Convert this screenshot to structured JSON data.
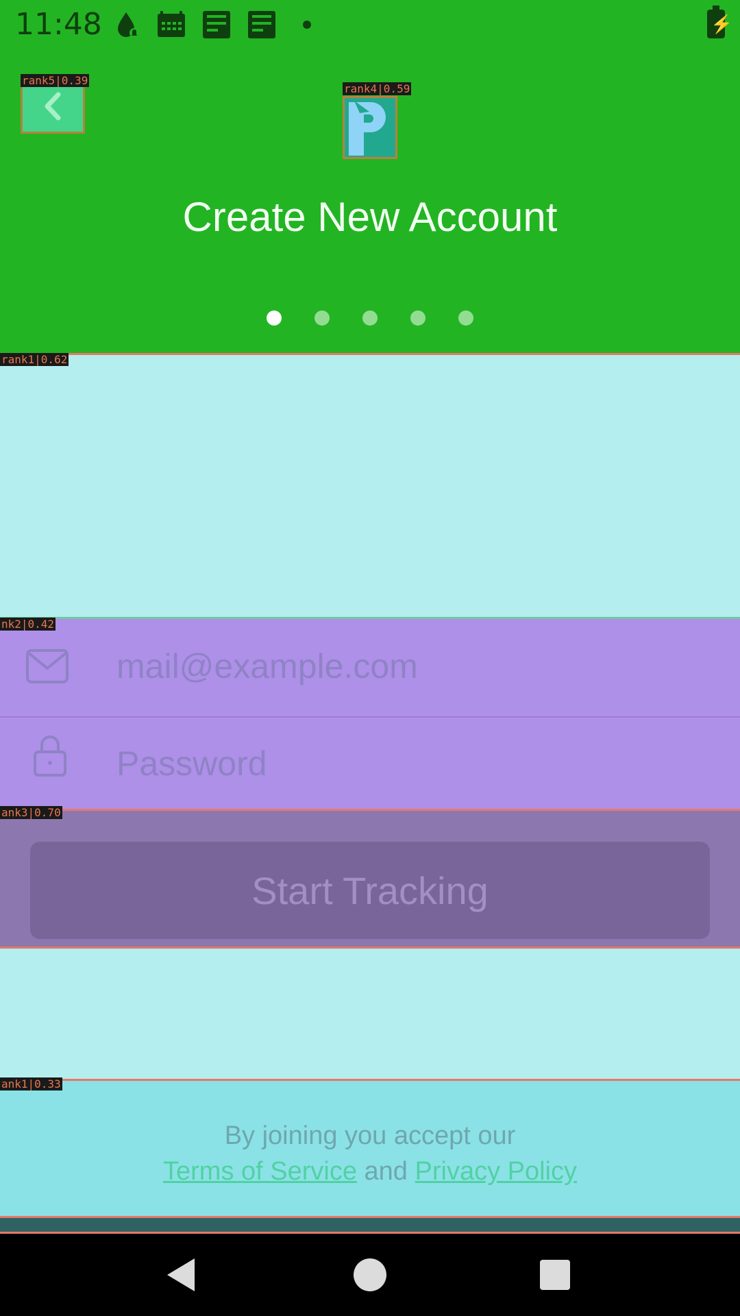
{
  "status_bar": {
    "time": "11:48"
  },
  "header": {
    "back_tag": "rank5|0.39",
    "logo_tag": "rank4|0.59",
    "title": "Create New Account",
    "pager": {
      "count": 5,
      "active_index": 0
    }
  },
  "regions": {
    "top_tag": "rank1|0.62",
    "form_tag": "nk2|0.42",
    "cta_tag": "ank3|0.70",
    "footer_tag": "ank1|0.33"
  },
  "form": {
    "email": {
      "placeholder": "mail@example.com",
      "icon": "mail-icon"
    },
    "password": {
      "placeholder": "Password",
      "icon": "lock-icon"
    }
  },
  "cta": {
    "label": "Start Tracking"
  },
  "footer": {
    "line1": "By joining you accept our",
    "terms": "Terms of Service",
    "and": "and",
    "privacy": "Privacy Policy"
  },
  "colors": {
    "header": "#23b423",
    "background": "#b4eeee",
    "form": "#ae90e8",
    "button": "#7a659a",
    "footer": "#8ae2e6",
    "link": "#52d1a4"
  }
}
